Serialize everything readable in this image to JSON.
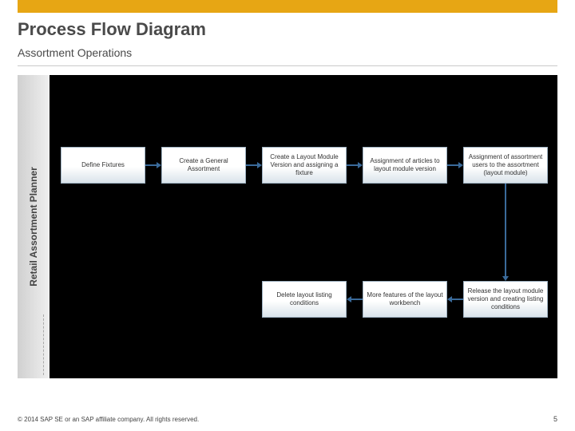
{
  "header": {
    "title": "Process Flow Diagram",
    "subtitle": "Assortment Operations"
  },
  "swimlane": {
    "label": "Retail Assortment Planner"
  },
  "steps": {
    "s1": "Define Fixtures",
    "s2": "Create a General Assortment",
    "s3": "Create a  Layout Module Version and assigning a fixture",
    "s4": "Assignment of articles to layout module version",
    "s5": "Assignment of assortment users to the assortment (layout module)",
    "s6": "Release the layout module version and creating listing conditions",
    "s7": "More features of the layout workbench",
    "s8": "Delete layout listing conditions"
  },
  "footer": {
    "copyright": "© 2014 SAP SE or an SAP affiliate company. All rights reserved.",
    "page": "5"
  },
  "chart_data": {
    "type": "table",
    "title": "Process Flow Diagram — Assortment Operations",
    "swimlane": "Retail Assortment Planner",
    "nodes": [
      {
        "id": "s1",
        "label": "Define Fixtures"
      },
      {
        "id": "s2",
        "label": "Create a General Assortment"
      },
      {
        "id": "s3",
        "label": "Create a Layout Module Version and assigning a fixture"
      },
      {
        "id": "s4",
        "label": "Assignment of articles to layout module version"
      },
      {
        "id": "s5",
        "label": "Assignment of assortment users to the assortment (layout module)"
      },
      {
        "id": "s6",
        "label": "Release the layout module version and creating listing conditions"
      },
      {
        "id": "s7",
        "label": "More features of the layout workbench"
      },
      {
        "id": "s8",
        "label": "Delete layout listing conditions"
      }
    ],
    "edges": [
      {
        "from": "s1",
        "to": "s2"
      },
      {
        "from": "s2",
        "to": "s3"
      },
      {
        "from": "s3",
        "to": "s4"
      },
      {
        "from": "s4",
        "to": "s5"
      },
      {
        "from": "s5",
        "to": "s6"
      },
      {
        "from": "s6",
        "to": "s7"
      },
      {
        "from": "s7",
        "to": "s8"
      }
    ]
  }
}
